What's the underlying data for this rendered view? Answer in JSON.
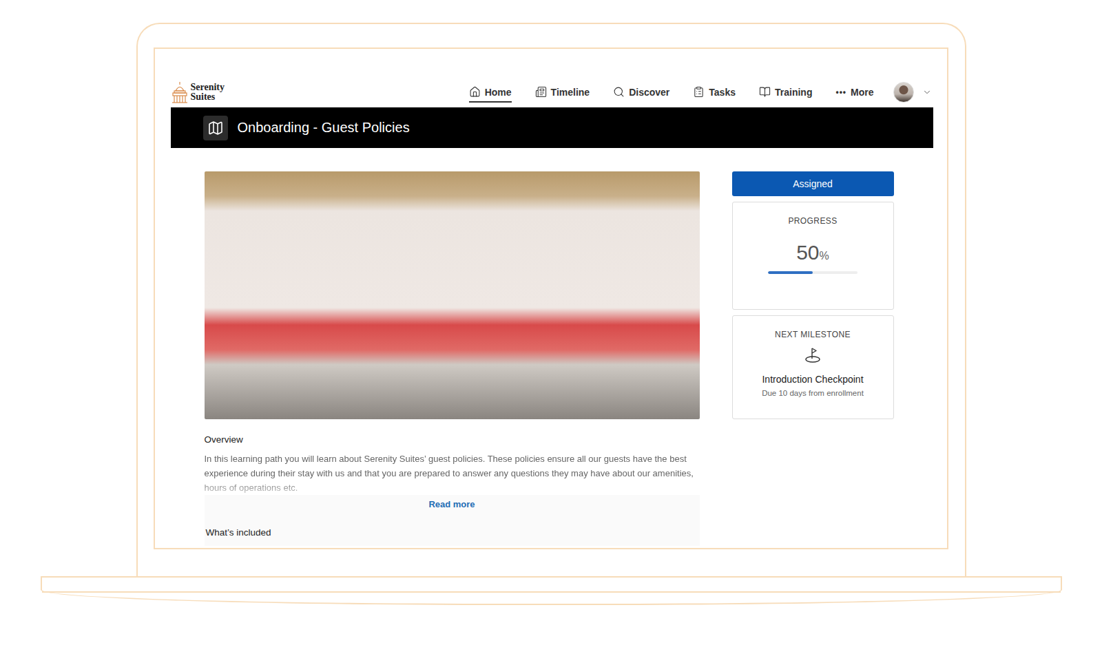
{
  "brand": {
    "line1": "Serenity",
    "line2": "Suites"
  },
  "nav": [
    {
      "label": "Home",
      "selected": true,
      "glyph": ""
    },
    {
      "label": "Timeline",
      "selected": false,
      "glyph": ""
    },
    {
      "label": "Discover",
      "selected": false,
      "glyph": ""
    },
    {
      "label": "Tasks",
      "selected": false,
      "glyph": ""
    },
    {
      "label": "Training",
      "selected": false,
      "glyph": ""
    },
    {
      "label": "More",
      "selected": false,
      "glyph": "•••"
    }
  ],
  "header": {
    "title": "Onboarding - Guest Policies"
  },
  "overview": {
    "heading": "Overview",
    "text": "In this learning path you will learn about Serenity Suites’ guest policies. These policies ensure all our guests have the best experience during their stay with us and that you are prepared to answer any questions they may have about our amenities, hours of operations etc.",
    "read_more": "Read more"
  },
  "included": {
    "heading": "What’s included"
  },
  "status": {
    "label": "Assigned"
  },
  "progress": {
    "label": "PROGRESS",
    "value": "50",
    "unit": "%",
    "level": 0.5
  },
  "milestone": {
    "label": "NEXT MILESTONE",
    "title": "Introduction Checkpoint",
    "due": "Due 10 days from enrollment"
  }
}
